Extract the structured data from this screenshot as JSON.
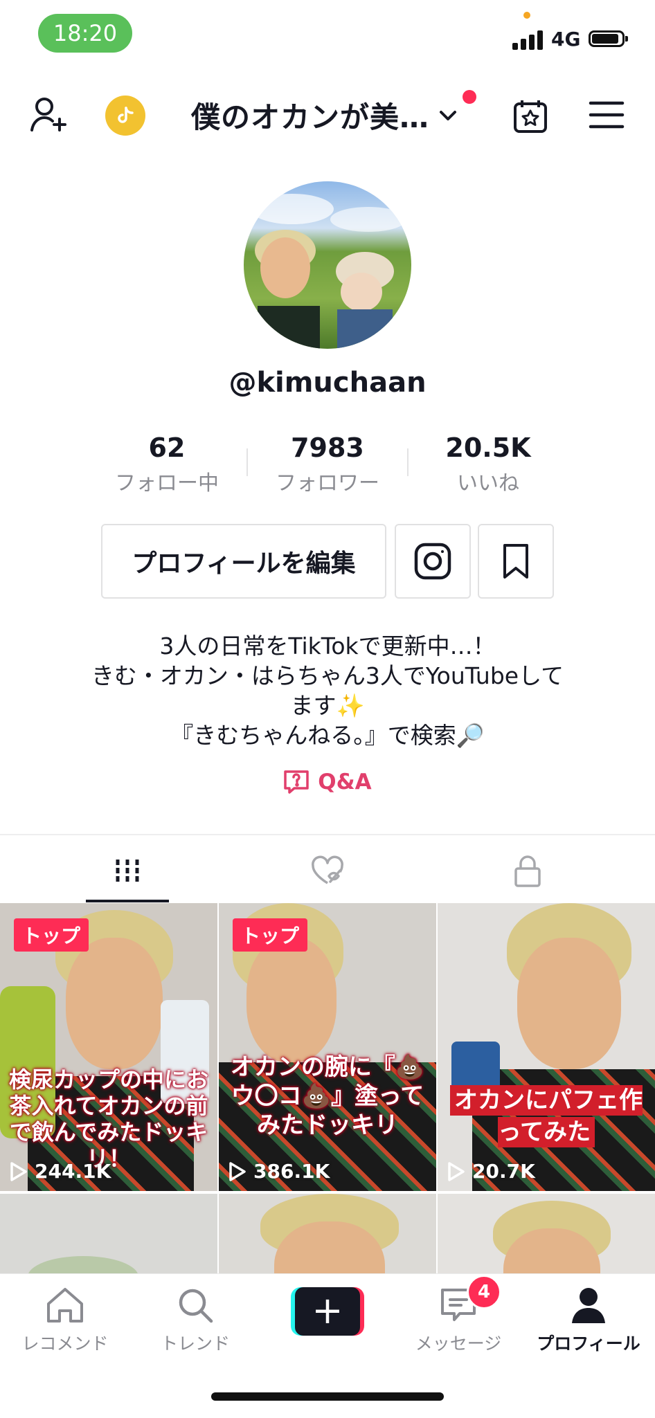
{
  "status_bar": {
    "time": "18:20",
    "network": "4G"
  },
  "header": {
    "title": "僕のオカンが美…"
  },
  "profile": {
    "username": "@kimuchaan",
    "stats": [
      {
        "value": "62",
        "label": "フォロー中"
      },
      {
        "value": "7983",
        "label": "フォロワー"
      },
      {
        "value": "20.5K",
        "label": "いいね"
      }
    ],
    "edit_label": "プロフィールを編集",
    "bio_lines": [
      "3人の日常をTikTokで更新中…！",
      "きむ・オカン・はらちゃん3人でYouTubeして",
      "ます✨",
      "『きむちゃんねる。』で検索🔎"
    ],
    "qa_label": "Q&A"
  },
  "tabs": [
    {
      "icon": "grid-icon",
      "active": true
    },
    {
      "icon": "heart-hidden-icon",
      "active": false
    },
    {
      "icon": "lock-icon",
      "active": false
    }
  ],
  "videos": [
    {
      "badge": "トップ",
      "caption": "検尿カップの中にお茶入れてオカンの前で飲んでみたドッキリ！",
      "views": "244.1K"
    },
    {
      "badge": "トップ",
      "caption": "オカンの腕に『💩ウ〇コ💩』塗ってみたドッキリ",
      "views": "386.1K"
    },
    {
      "badge": "",
      "caption": "オカンにパフェ作ってみた",
      "views": "20.7K"
    }
  ],
  "bottom_nav": {
    "items": [
      {
        "label": "レコメンド",
        "icon": "home-icon"
      },
      {
        "label": "トレンド",
        "icon": "search-icon"
      },
      {
        "label": "",
        "icon": "plus-icon"
      },
      {
        "label": "メッセージ",
        "icon": "message-icon"
      },
      {
        "label": "プロフィール",
        "icon": "profile-icon"
      }
    ],
    "message_badge": "4"
  },
  "colors": {
    "accent": "#fe2c55",
    "qa": "#e13f6c",
    "text": "#161823",
    "muted": "#8a8b91"
  }
}
